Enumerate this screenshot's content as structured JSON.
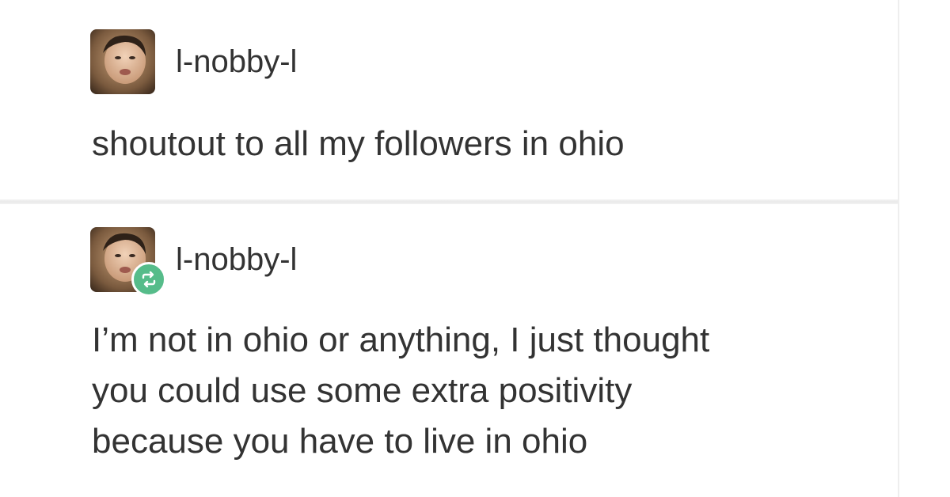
{
  "posts": [
    {
      "username": "l-nobby-l",
      "avatar_icon": "avatar-face",
      "reblogged": false,
      "body_lines": [
        "shoutout to all my followers in ohio"
      ]
    },
    {
      "username": "l-nobby-l",
      "avatar_icon": "avatar-face",
      "reblogged": true,
      "badge_icon": "reblog-icon",
      "badge_color": "#56bc8a",
      "body_lines": [
        "I’m not in ohio or anything, I just thought",
        "you could use some extra positivity",
        "because you have to live in ohio"
      ]
    }
  ],
  "colors": {
    "background": "#ffffff",
    "text": "#333333",
    "divider": "#eeeeee"
  }
}
